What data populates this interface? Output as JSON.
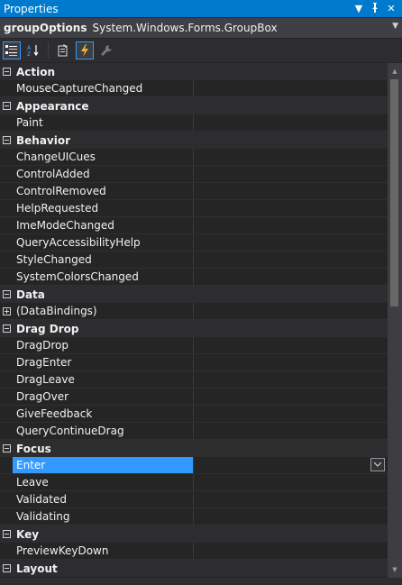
{
  "window": {
    "title": "Properties"
  },
  "object_selector": {
    "name": "groupOptions",
    "type": "System.Windows.Forms.GroupBox"
  },
  "toolbar": {
    "buttons": [
      {
        "id": "categorized",
        "icon": "categorized-icon",
        "active": true
      },
      {
        "id": "alphabetical",
        "icon": "alphabetical-icon",
        "active": false
      },
      {
        "id": "properties",
        "icon": "properties-icon",
        "active": false
      },
      {
        "id": "events",
        "icon": "events-lightning-icon",
        "active": true
      },
      {
        "id": "property-pages",
        "icon": "wrench-icon",
        "active": false
      }
    ]
  },
  "grid": {
    "rows": [
      {
        "kind": "category",
        "label": "Action"
      },
      {
        "kind": "property",
        "label": "MouseCaptureChanged",
        "value": ""
      },
      {
        "kind": "category",
        "label": "Appearance"
      },
      {
        "kind": "property",
        "label": "Paint",
        "value": ""
      },
      {
        "kind": "category",
        "label": "Behavior"
      },
      {
        "kind": "property",
        "label": "ChangeUICues",
        "value": ""
      },
      {
        "kind": "property",
        "label": "ControlAdded",
        "value": ""
      },
      {
        "kind": "property",
        "label": "ControlRemoved",
        "value": ""
      },
      {
        "kind": "property",
        "label": "HelpRequested",
        "value": ""
      },
      {
        "kind": "property",
        "label": "ImeModeChanged",
        "value": ""
      },
      {
        "kind": "property",
        "label": "QueryAccessibilityHelp",
        "value": ""
      },
      {
        "kind": "property",
        "label": "StyleChanged",
        "value": ""
      },
      {
        "kind": "property",
        "label": "SystemColorsChanged",
        "value": ""
      },
      {
        "kind": "category",
        "label": "Data"
      },
      {
        "kind": "property",
        "label": "(DataBindings)",
        "value": "",
        "expandable": true
      },
      {
        "kind": "category",
        "label": "Drag Drop"
      },
      {
        "kind": "property",
        "label": "DragDrop",
        "value": ""
      },
      {
        "kind": "property",
        "label": "DragEnter",
        "value": ""
      },
      {
        "kind": "property",
        "label": "DragLeave",
        "value": ""
      },
      {
        "kind": "property",
        "label": "DragOver",
        "value": ""
      },
      {
        "kind": "property",
        "label": "GiveFeedback",
        "value": ""
      },
      {
        "kind": "property",
        "label": "QueryContinueDrag",
        "value": ""
      },
      {
        "kind": "category",
        "label": "Focus"
      },
      {
        "kind": "property",
        "label": "Enter",
        "value": "",
        "selected": true
      },
      {
        "kind": "property",
        "label": "Leave",
        "value": ""
      },
      {
        "kind": "property",
        "label": "Validated",
        "value": ""
      },
      {
        "kind": "property",
        "label": "Validating",
        "value": ""
      },
      {
        "kind": "category",
        "label": "Key"
      },
      {
        "kind": "property",
        "label": "PreviewKeyDown",
        "value": ""
      },
      {
        "kind": "category",
        "label": "Layout"
      }
    ]
  },
  "colors": {
    "accent": "#007acc",
    "selection": "#3399ff",
    "background": "#252526",
    "category_background": "#2d2d30"
  }
}
